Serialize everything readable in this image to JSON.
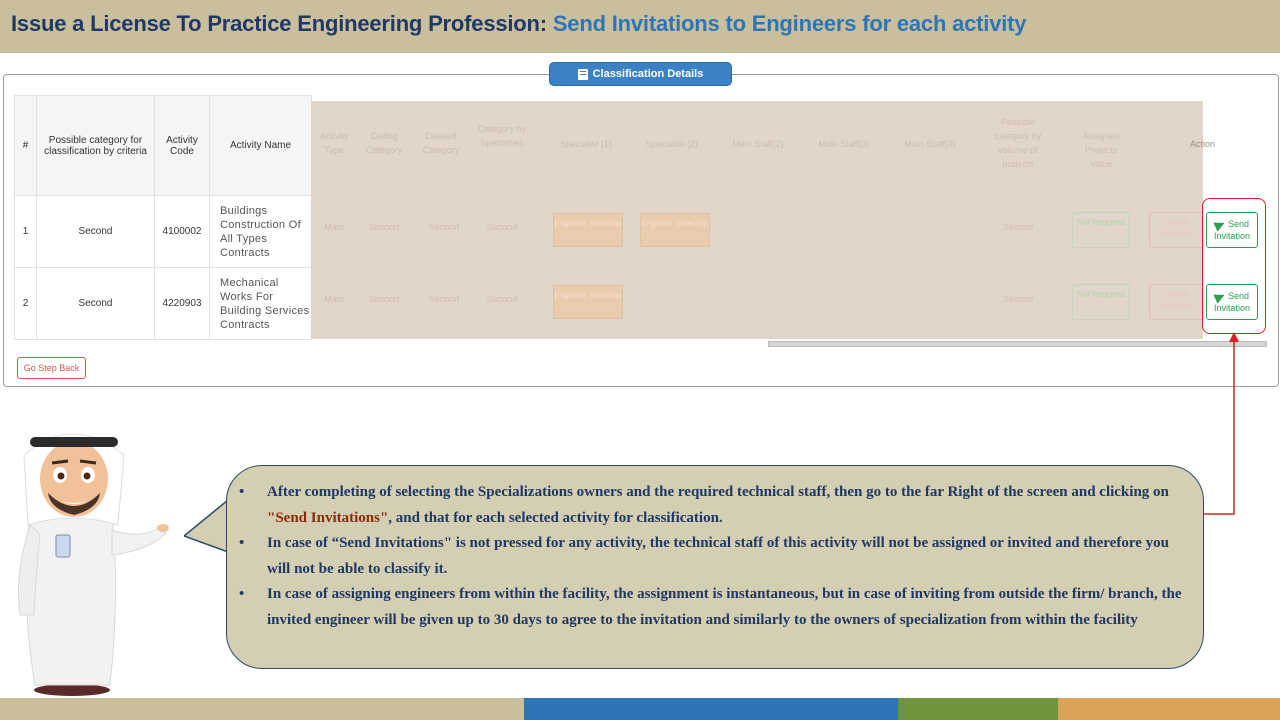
{
  "header": {
    "title": "Issue a License To Practice Engineering Profession:",
    "subtitle": " Send Invitations to Engineers for each activity"
  },
  "tab": {
    "label": "Classification Details",
    "icon": "book-icon"
  },
  "table": {
    "columns": [
      "#",
      "Possible category for classification by criteria",
      "Activity Code",
      "Activity Name"
    ],
    "rows": [
      {
        "num": "1",
        "category": "Second",
        "code": "4100002",
        "name": "Buildings Construction Of All Types Contracts"
      },
      {
        "num": "2",
        "category": "Second",
        "code": "4220903",
        "name": "Mechanical Works For Building Services Contracts"
      }
    ],
    "overlay_headers": [
      "Activity Type",
      "Ceiling Category",
      "Desired Category",
      "Category by Specialties",
      "Specialist (1)",
      "Specialist (2)",
      "Main Staff(2)",
      "Main Staff(3)",
      "Main Staff(4)",
      "Possible category by volume of projects",
      "Assigned Projects Value",
      "Action"
    ],
    "overlay_row": {
      "type": "Main",
      "ceiling": "Second",
      "desired": "Second",
      "specialties": "Second",
      "volume": "Second",
      "specialist_btn": "Engineer Selection",
      "not_required": "Not Required",
      "cancel": "Cancel Invitations"
    },
    "send_label": "Send Invitation"
  },
  "buttons": {
    "go_back": "Go Step Back"
  },
  "notes": {
    "item1_a": "After completing of selecting  the Specializations owners and the required technical  staff, then go to the far Right of the screen and clicking  on ",
    "item1_q": "\"Send Invitations\"",
    "item1_b": ", and that for each selected activity for classification.",
    "item2": "In case  of  “Send Invitations\" is not pressed for any activity, the technical  staff of this activity will not be assigned or invited and therefore you will not be able to classify it.",
    "item3": "In case of assigning  engineers from within the facility, the assignment is instantaneous, but in case of inviting from outside the firm/ branch, the invited engineer will be given up to 30 days to agree to the invitation and similarly to the owners of specialization from within the facility"
  },
  "colors": {
    "header_bg": "#c9bf9c",
    "title": "#1f3864",
    "subtitle": "#2e75b6",
    "accent_green": "#2e9e4f",
    "highlight_red": "#d82020",
    "footer": [
      "#c9bf9c",
      "#2e75b6",
      "#70943c",
      "#d8a258"
    ]
  }
}
